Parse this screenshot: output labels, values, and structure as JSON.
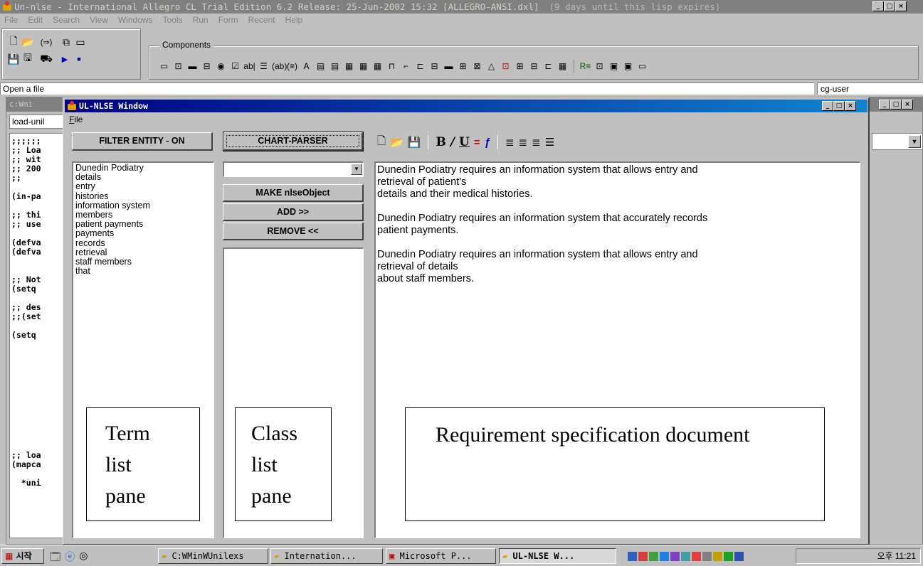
{
  "app": {
    "title": "Un-nlse - International Allegro CL Trial Edition 6.2 Release: 25-Jun-2002 15:32 [ALLEGRO-ANSI.dxl]",
    "expiry_note": "(9 days until this lisp expires)"
  },
  "menu": [
    "File",
    "Edit",
    "Search",
    "View",
    "Windows",
    "Tools",
    "Run",
    "Form",
    "Recent",
    "Help"
  ],
  "components_label": "Components",
  "status": {
    "message": "Open a file",
    "package": "cg-user"
  },
  "bg_window": {
    "title": "c:Wmi",
    "tab": "load-unil",
    "code_lines": [
      ";;;;;;",
      ";; Loa",
      ";; wit",
      ";; 200",
      ";;",
      "",
      "(in-pa",
      "",
      ";; thi",
      ";; use",
      "",
      "(defva",
      "(defva",
      "",
      "",
      ";; Not",
      "(setq",
      "",
      ";; des",
      ";;(set",
      "",
      "(setq",
      "",
      "",
      "",
      "",
      "",
      "",
      "",
      "",
      "",
      "",
      "",
      "",
      ";; loa",
      "(mapca",
      "",
      "  *uni"
    ]
  },
  "ul_window": {
    "title": "UL-NLSE Window",
    "menu_file": "File",
    "filter_button": "FILTER ENTITY - ON",
    "chart_parser_button": "CHART-PARSER",
    "combo_value": "",
    "make_button": "MAKE nlseObject",
    "add_button": "ADD >>",
    "remove_button": "REMOVE <<",
    "terms": [
      "Dunedin Podiatry",
      "details",
      "entry",
      "histories",
      "information system",
      "members",
      "patient payments",
      "payments",
      "records",
      "retrieval",
      "staff members",
      "that"
    ],
    "document": [
      "Dunedin Podiatry requires an information system that allows entry and\nretrieval of patient's\ndetails and their medical histories.",
      "Dunedin Podiatry requires an information system that accurately records\npatient payments.",
      "Dunedin Podiatry requires an information system that allows entry and\nretrieval of details\nabout staff members."
    ]
  },
  "annotations": {
    "term_pane": "Term\nlist\npane",
    "class_pane": "Class\nlist\npane",
    "doc_pane": "Requirement specification document"
  },
  "taskbar": {
    "start": "시작",
    "tasks": [
      "C:WMinWUnilexs",
      "Internation...",
      "Microsoft P...",
      "UL-NLSE W..."
    ],
    "clock": "오후 11:21"
  }
}
